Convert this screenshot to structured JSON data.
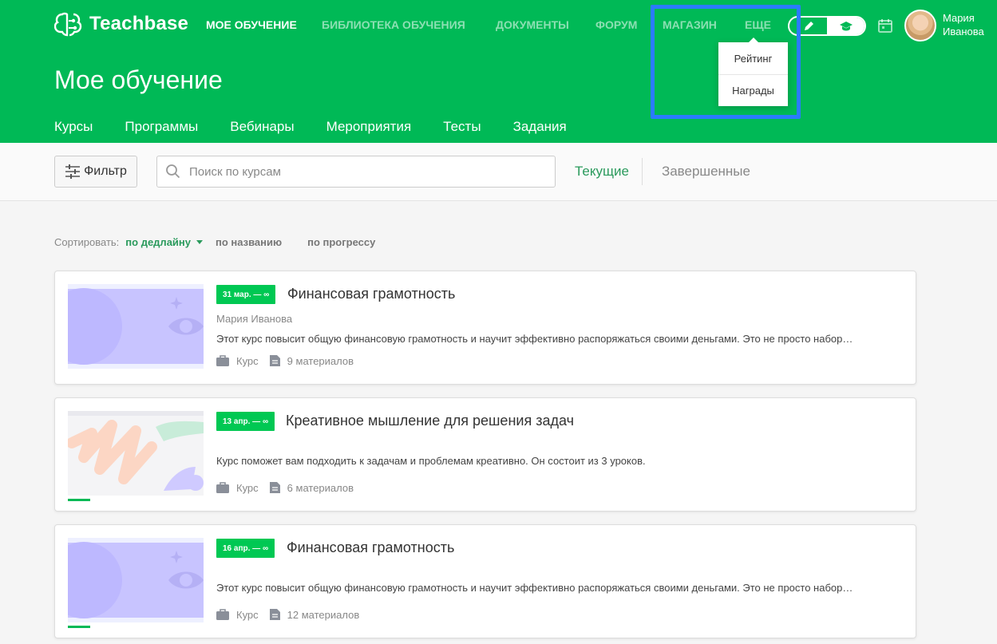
{
  "app": {
    "name": "Teachbase"
  },
  "nav": [
    {
      "label": "МОЕ ОБУЧЕНИЕ",
      "active": true
    },
    {
      "label": "БИБЛИОТЕКА ОБУЧЕНИЯ",
      "active": false
    },
    {
      "label": "ДОКУМЕНТЫ",
      "active": false
    },
    {
      "label": "ФОРУМ",
      "active": false
    },
    {
      "label": "МАГАЗИН",
      "active": false
    },
    {
      "label": "ЕЩЕ",
      "active": false
    }
  ],
  "more_menu": [
    "Рейтинг",
    "Награды"
  ],
  "user": {
    "first_name": "Мария",
    "last_name": "Иванова"
  },
  "page": {
    "title": "Мое обучение"
  },
  "tabs": [
    "Курсы",
    "Программы",
    "Вебинары",
    "Мероприятия",
    "Тесты",
    "Задания"
  ],
  "toolbar": {
    "filter_label": "Фильтр",
    "search_placeholder": "Поиск по курсам",
    "status_current": "Текущие",
    "status_completed": "Завершенные"
  },
  "sort": {
    "label": "Сортировать:",
    "options": [
      "по дедлайну",
      "по названию",
      "по прогрессу"
    ],
    "active": "по дедлайну"
  },
  "courses": [
    {
      "date": "31 мар. — ∞",
      "title": "Финансовая грамотность",
      "author": "Мария Иванова",
      "description": "Этот курс повысит общую финансовую грамотность и научит эффективно распоряжаться своими деньгами. Это не просто набор…",
      "type": "Курс",
      "materials": "9 материалов"
    },
    {
      "date": "13 апр. — ∞",
      "title": "Креативное мышление для решения задач",
      "author": "",
      "description": "Курс поможет вам подходить к задачам и проблемам креативно. Он состоит из 3 уроков.",
      "type": "Курс",
      "materials": "6 материалов"
    },
    {
      "date": "16 апр. — ∞",
      "title": "Финансовая грамотность",
      "author": "",
      "description": "Этот курс повысит общую финансовую грамотность и научит эффективно распоряжаться своими деньгами. Это не просто набор…",
      "type": "Курс",
      "materials": "12 материалов"
    }
  ],
  "colors": {
    "brand_green": "#00b956",
    "badge_green": "#00c853",
    "highlight": "#2b7bff",
    "active_text": "#2a9a5c"
  }
}
